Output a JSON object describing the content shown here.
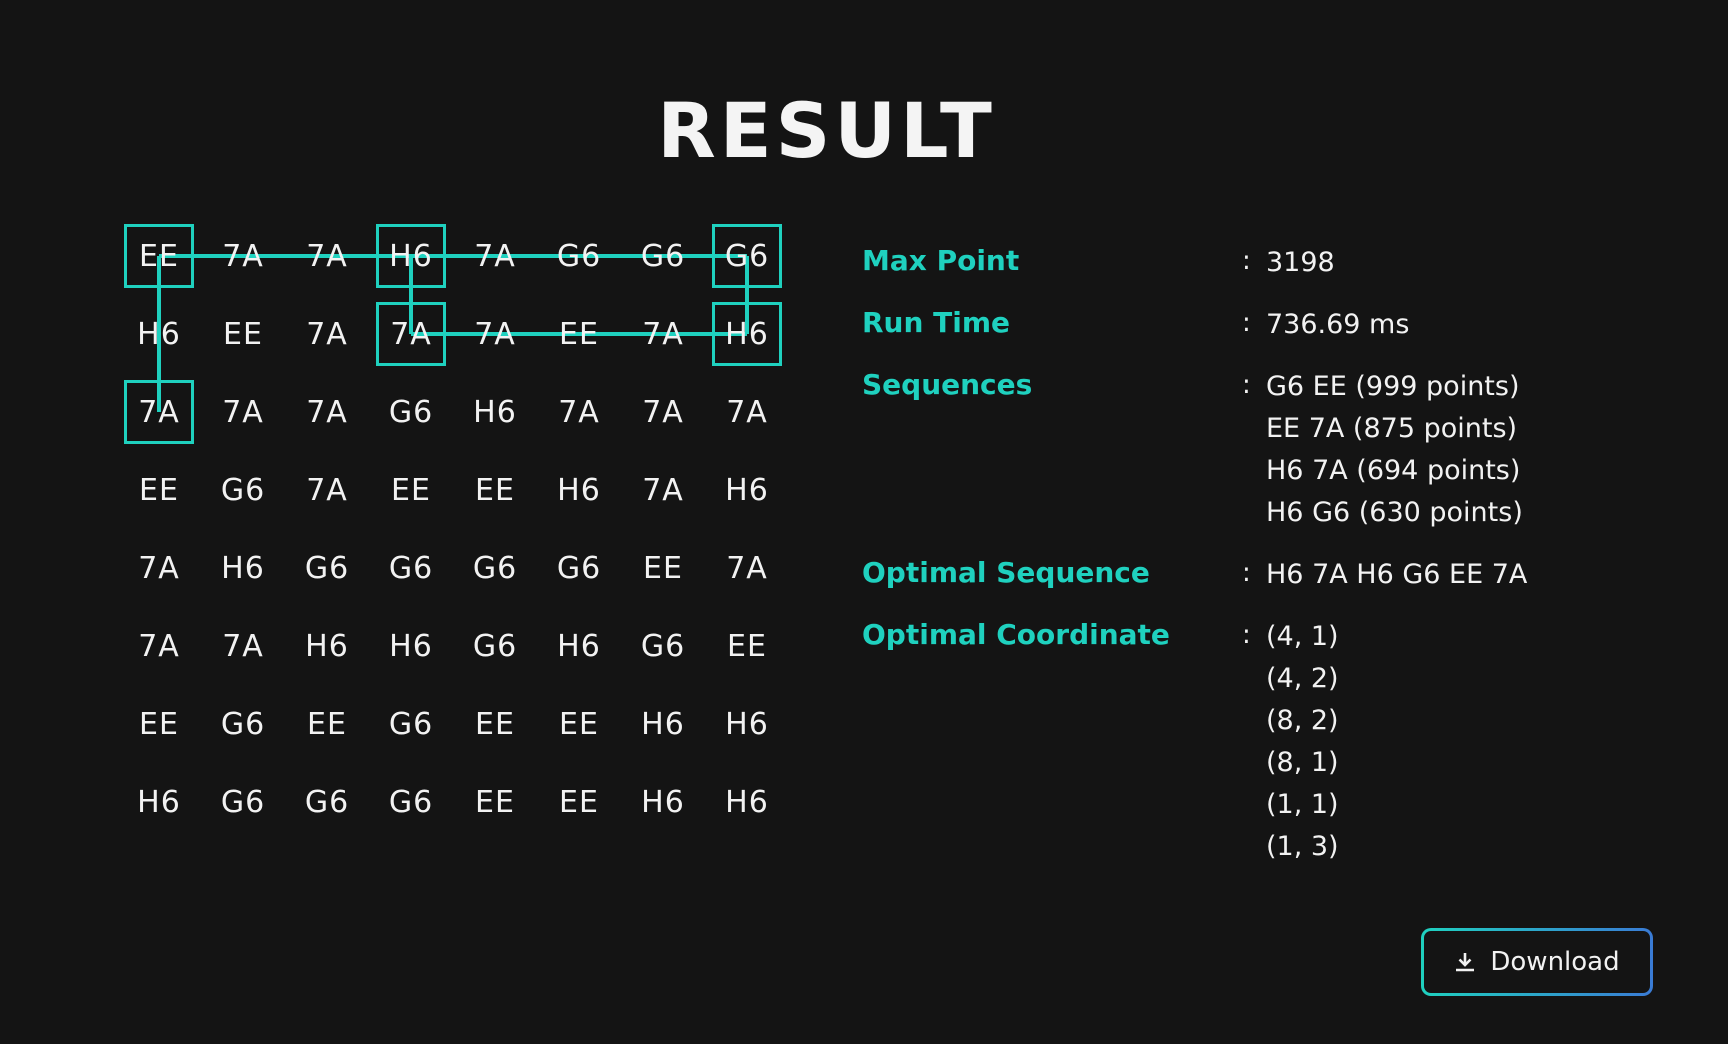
{
  "title": "RESULT",
  "colors": {
    "background": "#141414",
    "accent": "#1fd1bf",
    "text": "#f2f2f2",
    "button_gradient_end": "#3a7bd5"
  },
  "matrix": {
    "rows": [
      [
        "EE",
        "7A",
        "7A",
        "H6",
        "7A",
        "G6",
        "G6",
        "G6"
      ],
      [
        "H6",
        "EE",
        "7A",
        "7A",
        "7A",
        "EE",
        "7A",
        "H6"
      ],
      [
        "7A",
        "7A",
        "7A",
        "G6",
        "H6",
        "7A",
        "7A",
        "7A"
      ],
      [
        "EE",
        "G6",
        "7A",
        "EE",
        "EE",
        "H6",
        "7A",
        "H6"
      ],
      [
        "7A",
        "H6",
        "G6",
        "G6",
        "G6",
        "G6",
        "EE",
        "7A"
      ],
      [
        "7A",
        "7A",
        "H6",
        "H6",
        "G6",
        "H6",
        "G6",
        "EE"
      ],
      [
        "EE",
        "G6",
        "EE",
        "G6",
        "EE",
        "EE",
        "H6",
        "H6"
      ],
      [
        "H6",
        "G6",
        "G6",
        "G6",
        "EE",
        "EE",
        "H6",
        "H6"
      ]
    ]
  },
  "info": {
    "max_point_label": "Max Point",
    "max_point_value": "3198",
    "run_time_label": "Run Time",
    "run_time_value": "736.69 ms",
    "sequences_label": "Sequences",
    "sequences": [
      "G6 EE (999 points)",
      "EE 7A (875 points)",
      "H6 7A (694 points)",
      "H6 G6 (630 points)"
    ],
    "optimal_sequence_label": "Optimal Sequence",
    "optimal_sequence_value": "H6 7A H6 G6 EE 7A",
    "optimal_coordinate_label": "Optimal Coordinate",
    "optimal_coordinates": [
      "(4, 1)",
      "(4, 2)",
      "(8, 2)",
      "(8, 1)",
      "(1, 1)",
      "(1, 3)"
    ],
    "colon": ":"
  },
  "download_label": "Download",
  "download_icon": "download-icon"
}
